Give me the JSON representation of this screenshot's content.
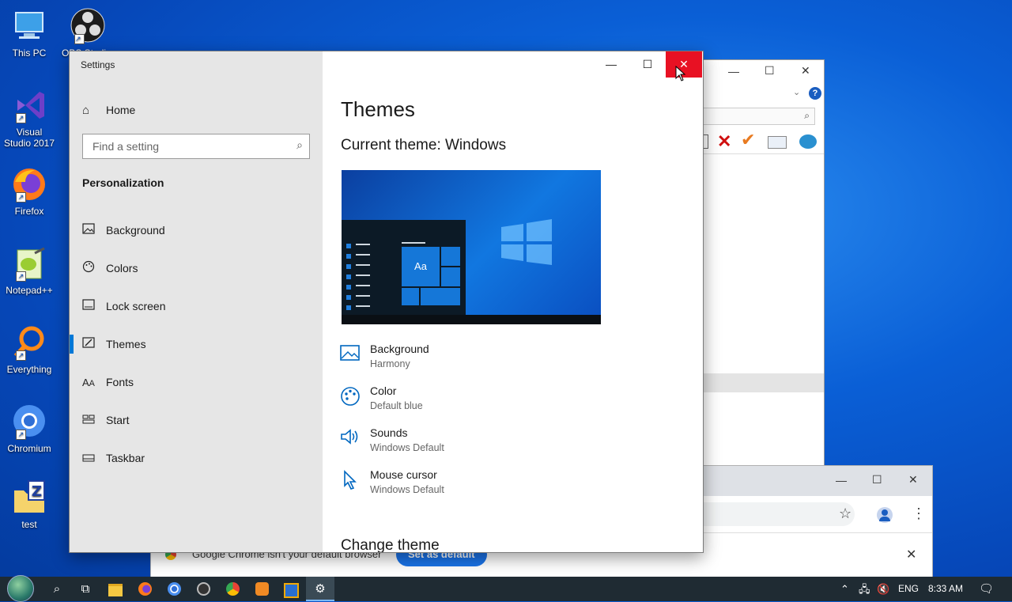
{
  "desktop": {
    "icons": [
      {
        "label": "This PC"
      },
      {
        "label": "OBS Studio"
      },
      {
        "label": "Visual Studio 2017"
      },
      {
        "label": "Firefox"
      },
      {
        "label": "Notepad++"
      },
      {
        "label": "Everything"
      },
      {
        "label": "Chromium"
      },
      {
        "label": "test"
      }
    ]
  },
  "chrome_notice": {
    "text": "Google Chrome isn't your default browser",
    "button": "Set as default"
  },
  "settings": {
    "title": "Settings",
    "home": "Home",
    "search_placeholder": "Find a setting",
    "section": "Personalization",
    "nav": [
      {
        "label": "Background",
        "icon": "image-icon"
      },
      {
        "label": "Colors",
        "icon": "palette-icon"
      },
      {
        "label": "Lock screen",
        "icon": "lock-screen-icon"
      },
      {
        "label": "Themes",
        "icon": "brush-icon"
      },
      {
        "label": "Fonts",
        "icon": "font-icon"
      },
      {
        "label": "Start",
        "icon": "start-icon"
      },
      {
        "label": "Taskbar",
        "icon": "taskbar-icon"
      }
    ],
    "selected": "Themes",
    "page_title": "Themes",
    "current_theme": "Current theme: Windows",
    "preview_tile": "Aa",
    "properties": [
      {
        "name": "Background",
        "value": "Harmony",
        "icon": "image-icon"
      },
      {
        "name": "Color",
        "value": "Default blue",
        "icon": "palette-icon"
      },
      {
        "name": "Sounds",
        "value": "Windows Default",
        "icon": "speaker-icon"
      },
      {
        "name": "Mouse cursor",
        "value": "Windows Default",
        "icon": "cursor-icon"
      }
    ],
    "change_theme": "Change theme",
    "accent_color": "#0078d7",
    "close_color": "#e81123"
  },
  "taskbar": {
    "language": "ENG",
    "time": "8:33 AM"
  }
}
